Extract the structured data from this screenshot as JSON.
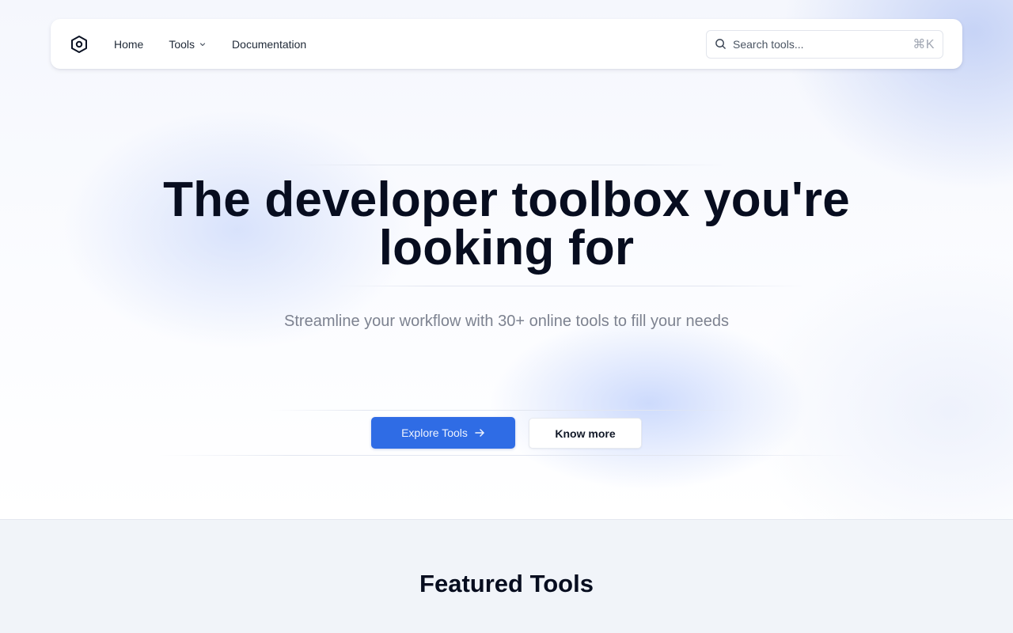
{
  "nav": {
    "logo_icon": "hexagon-icon",
    "links": [
      {
        "label": "Home"
      },
      {
        "label": "Tools",
        "icon": "chevron-down-icon"
      },
      {
        "label": "Documentation"
      }
    ],
    "search": {
      "placeholder": "Search tools...",
      "icon": "search-icon",
      "shortcut": "⌘K"
    }
  },
  "hero": {
    "headline": "The developer toolbox you're looking for",
    "subtitle": "Streamline your workflow with 30+ online tools to fill your needs",
    "primary_button": {
      "label": "Explore Tools",
      "icon": "arrow-right-icon"
    },
    "secondary_button": {
      "label": "Know more"
    }
  },
  "featured": {
    "title": "Featured Tools"
  },
  "colors": {
    "accent": "#2f6ce5",
    "heading": "#070d1f",
    "muted_text": "#7d8290",
    "section_bg": "#f1f4f9"
  }
}
